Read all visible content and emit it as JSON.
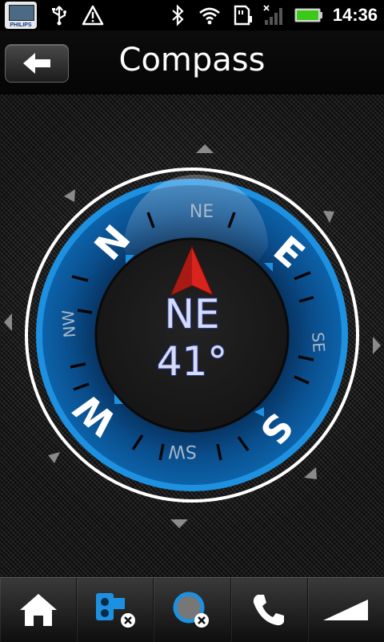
{
  "status_bar": {
    "time": "14:36",
    "app_icon_brand": "PHILIPS",
    "icons": [
      "app-notification-icon",
      "usb-icon",
      "warning-icon",
      "bluetooth-icon",
      "wifi-icon",
      "sd-card-icon",
      "signal-icon",
      "battery-icon"
    ]
  },
  "header": {
    "title": "Compass",
    "back_icon": "back-arrow-icon"
  },
  "compass": {
    "heading_label": "NE",
    "heading_degrees": "41°",
    "bezel_labels": {
      "N": "N",
      "NE": "NE",
      "E": "E",
      "SE": "SE",
      "S": "S",
      "SW": "SW",
      "W": "W",
      "NW": "NW"
    },
    "accent_color": "#1e90e0",
    "needle_color": "#d8241c"
  },
  "bottom_bar": {
    "items": [
      "home-icon",
      "speed-camera-off-icon",
      "recording-off-icon",
      "phone-icon",
      "signal-strength-icon"
    ]
  }
}
